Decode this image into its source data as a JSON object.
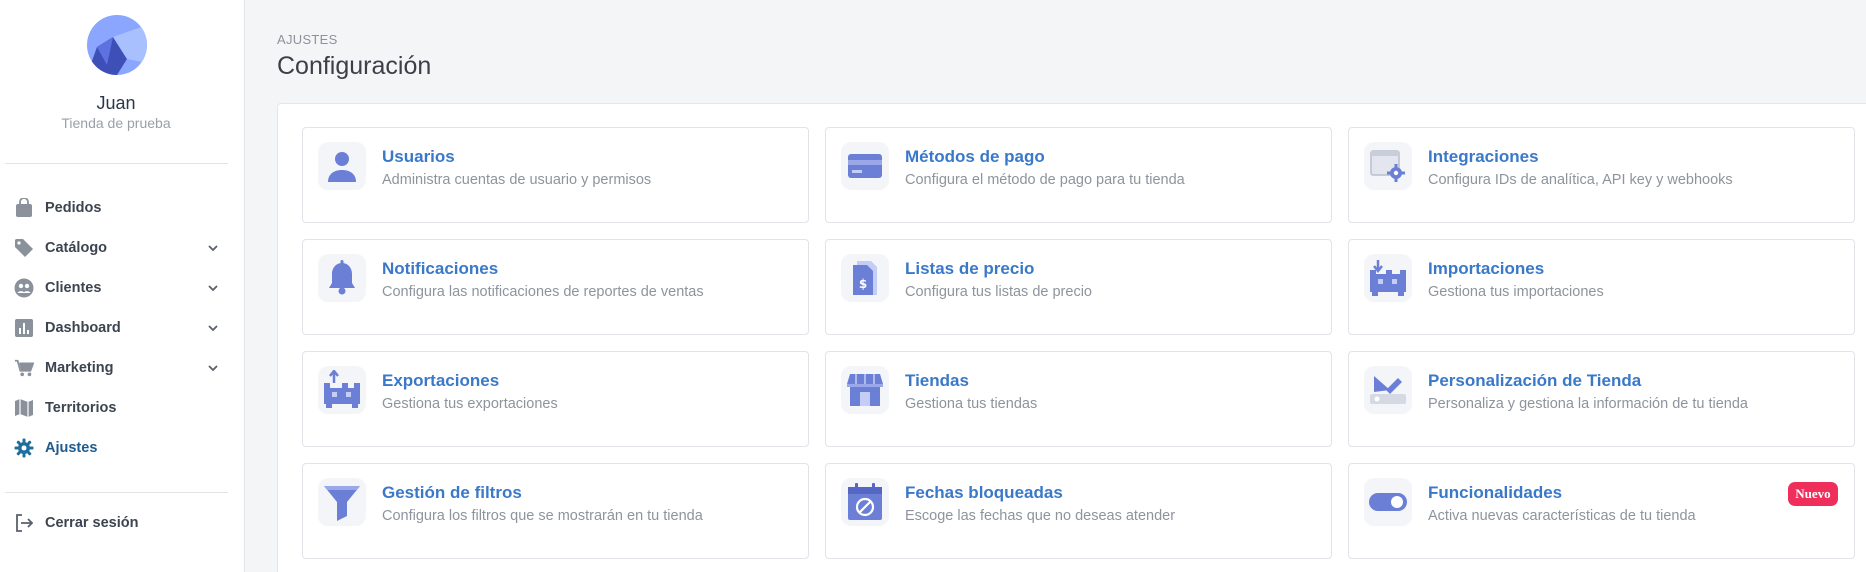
{
  "user": {
    "name": "Juan",
    "store": "Tienda de prueba"
  },
  "sidebar": {
    "items": [
      {
        "label": "Pedidos",
        "icon": "shopping-bag-icon",
        "chevron": false,
        "active": false
      },
      {
        "label": "Catálogo",
        "icon": "tag-icon",
        "chevron": true,
        "active": false
      },
      {
        "label": "Clientes",
        "icon": "users-icon",
        "chevron": true,
        "active": false
      },
      {
        "label": "Dashboard",
        "icon": "bar-chart-icon",
        "chevron": true,
        "active": false
      },
      {
        "label": "Marketing",
        "icon": "cart-icon",
        "chevron": true,
        "active": false
      },
      {
        "label": "Territorios",
        "icon": "map-icon",
        "chevron": false,
        "active": false
      },
      {
        "label": "Ajustes",
        "icon": "gear-icon",
        "chevron": false,
        "active": true
      }
    ],
    "logout_label": "Cerrar sesión"
  },
  "header": {
    "eyebrow": "AJUSTES",
    "title": "Configuración"
  },
  "cards": [
    {
      "title": "Usuarios",
      "desc": "Administra cuentas de usuario y permisos",
      "icon": "user-icon"
    },
    {
      "title": "Métodos de pago",
      "desc": "Configura el método de pago para tu tienda",
      "icon": "credit-card-icon"
    },
    {
      "title": "Integraciones",
      "desc": "Configura IDs de analítica, API key y webhooks",
      "icon": "integration-gear-icon"
    },
    {
      "title": "Notificaciones",
      "desc": "Configura las notificaciones de reportes de ventas",
      "icon": "bell-icon"
    },
    {
      "title": "Listas de precio",
      "desc": "Configura tus listas de precio",
      "icon": "price-list-icon"
    },
    {
      "title": "Importaciones",
      "desc": "Gestiona tus importaciones",
      "icon": "import-icon"
    },
    {
      "title": "Exportaciones",
      "desc": "Gestiona tus exportaciones",
      "icon": "export-icon"
    },
    {
      "title": "Tiendas",
      "desc": "Gestiona tus tiendas",
      "icon": "store-icon"
    },
    {
      "title": "Personalización de Tienda",
      "desc": "Personaliza y gestiona la información de tu tienda",
      "icon": "customize-icon"
    },
    {
      "title": "Gestión de filtros",
      "desc": "Configura los filtros que se mostrarán en tu tienda",
      "icon": "filter-icon"
    },
    {
      "title": "Fechas bloqueadas",
      "desc": "Escoge las fechas que no deseas atender",
      "icon": "blocked-calendar-icon"
    },
    {
      "title": "Funcionalidades",
      "desc": "Activa nuevas características de tu tienda",
      "icon": "toggle-icon",
      "badge": "Nuevo"
    }
  ],
  "colors": {
    "accent": "#3a78c9",
    "icon": "#6b7fd6",
    "badge": "#f02e5b",
    "highlight": "#f5ee1f",
    "active_nav": "#1f5b8c"
  }
}
